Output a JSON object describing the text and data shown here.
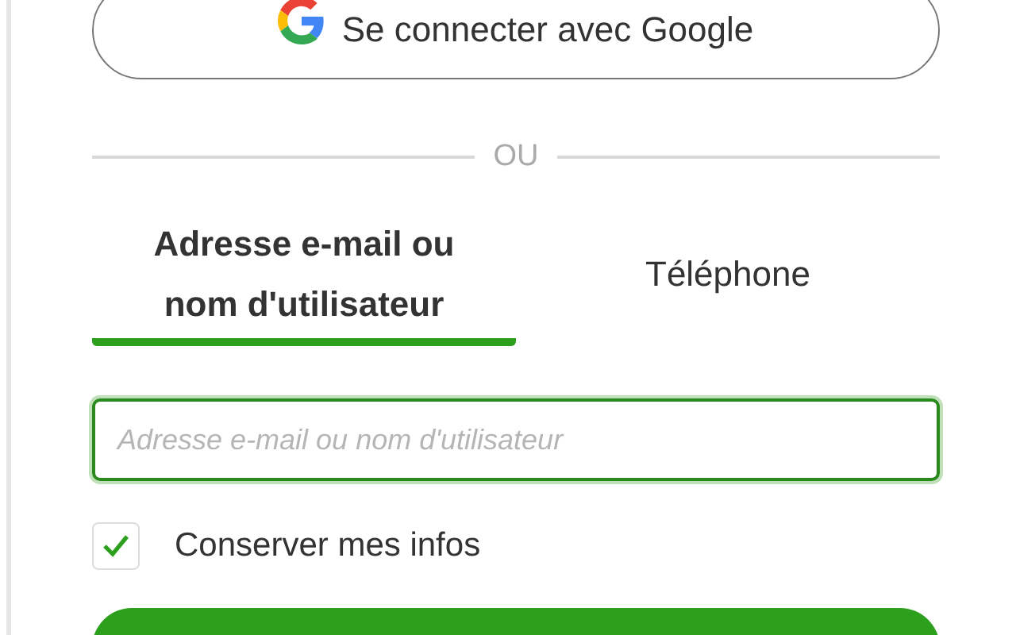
{
  "google_button": {
    "label": "Se connecter avec Google"
  },
  "divider": {
    "label": "OU"
  },
  "tabs": [
    {
      "label": "Adresse e-mail ou nom d'utilisateur",
      "selected": true
    },
    {
      "label": "Téléphone",
      "selected": false
    }
  ],
  "login_field": {
    "placeholder": "Adresse e-mail ou nom d'utilisateur",
    "focused": true
  },
  "remember": {
    "label": "Conserver mes infos",
    "checked": true
  }
}
